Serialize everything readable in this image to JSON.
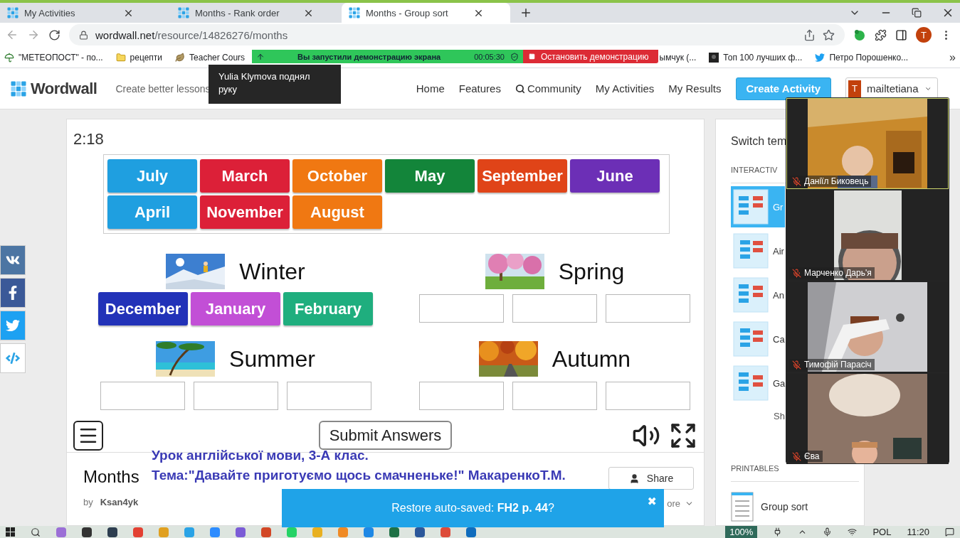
{
  "browser": {
    "tabs": [
      {
        "title": "My Activities",
        "selected": false
      },
      {
        "title": "Months - Rank order",
        "selected": false
      },
      {
        "title": "Months - Group sort",
        "selected": true
      }
    ],
    "address": {
      "host": "wordwall.net",
      "path": "/resource/14826276/months"
    },
    "profile": "T",
    "bookmarks": [
      {
        "label": "\"МЕТЕОПОСТ\" - по...",
        "kind": "umbrella"
      },
      {
        "label": "рецепти",
        "kind": "folder"
      },
      {
        "label": "Teacher Cours",
        "kind": "leaf"
      },
      {
        "label": "ымчук (...",
        "kind": "none"
      },
      {
        "label": "Топ 100 лучших ф...",
        "kind": "thumb"
      },
      {
        "label": "Петро Порошенко...",
        "kind": "bird"
      }
    ],
    "more": "»"
  },
  "screen_share": {
    "status": "Вы запустили демонстрацию экрана",
    "timer": "00:05:30",
    "stop": "Остановить демонстрацию"
  },
  "notification": {
    "text": "Yulia Klymova поднял руку"
  },
  "site": {
    "logo": "Wordwall",
    "tagline": "Create better lessons",
    "nav": [
      {
        "label": "Home",
        "kind": "link"
      },
      {
        "label": "Features",
        "kind": "link"
      },
      {
        "label": "Community",
        "kind": "search"
      },
      {
        "label": "My Activities",
        "kind": "link"
      },
      {
        "label": "My Results",
        "kind": "link"
      }
    ],
    "create_button": "Create Activity",
    "user": {
      "initial": "T",
      "name": "mailtetiana"
    }
  },
  "game": {
    "timer": "2:18",
    "pool": [
      {
        "label": "July",
        "color": "#1f9fe0"
      },
      {
        "label": "March",
        "color": "#dc2038"
      },
      {
        "label": "October",
        "color": "#f07812"
      },
      {
        "label": "May",
        "color": "#13853a"
      },
      {
        "label": "September",
        "color": "#e04418"
      },
      {
        "label": "June",
        "color": "#6c2fb6"
      },
      {
        "label": "April",
        "color": "#1f9fe0"
      },
      {
        "label": "November",
        "color": "#dc2038"
      },
      {
        "label": "August",
        "color": "#f07812"
      }
    ],
    "groups": [
      {
        "title": "Winter",
        "items": [
          {
            "kind": "tile",
            "label": "December",
            "color": "#2232b8"
          },
          {
            "kind": "tile",
            "label": "January",
            "color": "#c24fd6"
          },
          {
            "kind": "tile",
            "label": "February",
            "color": "#1fae7e"
          }
        ]
      },
      {
        "title": "Spring",
        "items": [
          {
            "kind": "empty"
          },
          {
            "kind": "empty"
          },
          {
            "kind": "empty"
          }
        ]
      },
      {
        "title": "Summer",
        "items": [
          {
            "kind": "empty"
          },
          {
            "kind": "empty"
          },
          {
            "kind": "empty"
          }
        ]
      },
      {
        "title": "Autumn",
        "items": [
          {
            "kind": "empty"
          },
          {
            "kind": "empty"
          },
          {
            "kind": "empty"
          }
        ]
      }
    ],
    "submit": "Submit Answers"
  },
  "activity": {
    "title": "Months",
    "by": "by",
    "author": "Ksan4yk",
    "share": "Share",
    "more": "ore"
  },
  "caption": [
    "Урок англійської мови, 3-А клас.",
    "Тема:\"Давайте приготуємо щось смачненьке!\" МакаренкоТ.М."
  ],
  "toast": {
    "text": "Restore auto-saved: **FH2 p. 44**?",
    "close": "✖"
  },
  "sidebar": {
    "switch": "Switch tem",
    "interactive": "INTERACTIV",
    "templates": [
      {
        "label": "Gr",
        "selected": true
      },
      {
        "label": "Air",
        "selected": false
      },
      {
        "label": "An",
        "selected": false
      },
      {
        "label": "Ca",
        "selected": false
      },
      {
        "label": "Ga",
        "selected": false
      }
    ],
    "show": "Sh",
    "printables": "PRINTABLES",
    "printable_items": [
      "Group sort"
    ]
  },
  "video": [
    {
      "name": "Даніїл Биковець",
      "muted": true,
      "active": true
    },
    {
      "name": "Марченко Дарь'я",
      "muted": true,
      "active": false
    },
    {
      "name": "Тимофій Парасіч",
      "muted": true,
      "active": false
    },
    {
      "name": "Єва",
      "muted": true,
      "active": false
    }
  ],
  "taskbar": {
    "zoom": "100%",
    "language": "POL",
    "time": "11:20"
  }
}
